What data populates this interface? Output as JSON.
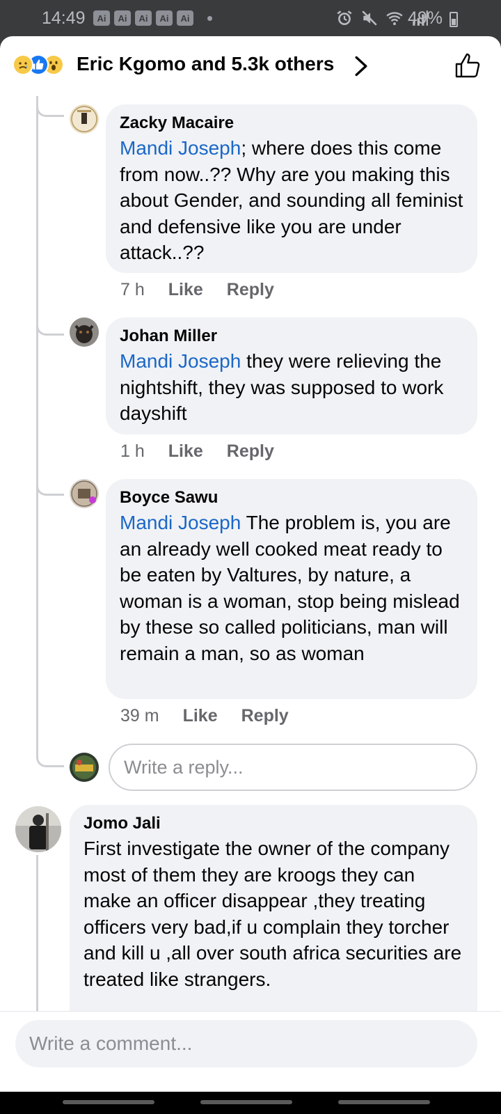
{
  "status_bar": {
    "time": "14:49",
    "ai_badges": [
      "Ai",
      "Ai",
      "Ai",
      "Ai",
      "Ai"
    ],
    "battery": "49%",
    "icons": [
      "alarm-icon",
      "mute-icon",
      "wifi-icon",
      "signal-icon",
      "battery-icon"
    ]
  },
  "header": {
    "reactions": [
      "sad-reaction-icon",
      "like-reaction-icon",
      "wow-reaction-icon"
    ],
    "title": "Eric Kgomo and 5.3k others"
  },
  "replies": [
    {
      "author": "Zacky Macaire",
      "mention": "Mandi Joseph",
      "text": "; where does this come from now..?? Why are you making this about Gender, and sounding all feminist and defensive like you are under attack..??",
      "time": "7 h",
      "like": "Like",
      "reply": "Reply"
    },
    {
      "author": "Johan Miller",
      "mention": "Mandi Joseph",
      "text": " they were relieving the nightshift, they was supposed to work dayshift",
      "time": "1 h",
      "like": "Like",
      "reply": "Reply"
    },
    {
      "author": "Boyce Sawu",
      "mention": "Mandi Joseph",
      "text": " The problem is, you are an already well cooked meat ready to be eaten by Valtures, by nature, a woman is a woman, stop being mislead by these so called politicians, man will remain a  man, so as woman",
      "time": "39 m",
      "like": "Like",
      "reply": "Reply"
    }
  ],
  "reply_input": {
    "placeholder": "Write a reply..."
  },
  "comment": {
    "author": "Jomo Jali",
    "text": "First investigate the owner of the company most of them they are kroogs they can make an officer disappear ,they treating officers very bad,if u complain they torcher and kill u ,all over south africa securities are treated like strangers."
  },
  "comment_input": {
    "placeholder": "Write a comment..."
  }
}
